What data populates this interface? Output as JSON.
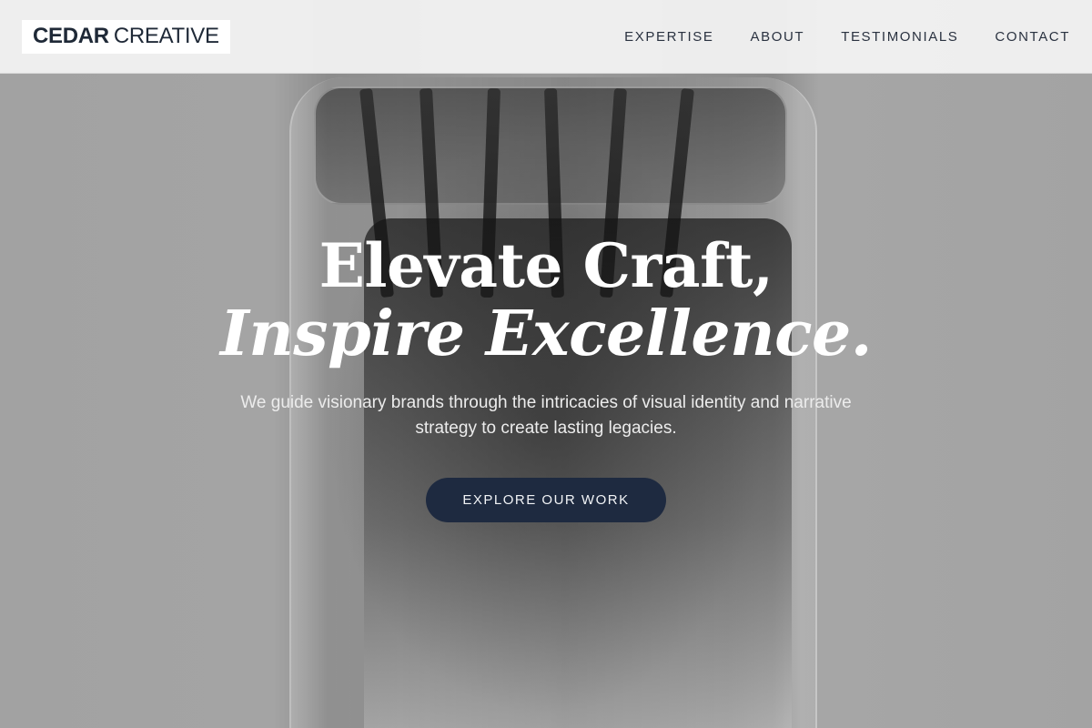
{
  "brand": {
    "name_bold": "CEDAR",
    "name_light": "CREATIVE"
  },
  "nav": {
    "items": [
      {
        "label": "EXPERTISE"
      },
      {
        "label": "ABOUT"
      },
      {
        "label": "TESTIMONIALS"
      },
      {
        "label": "CONTACT"
      }
    ]
  },
  "hero": {
    "headline_line1": "Elevate Craft,",
    "headline_line2": "Inspire Excellence.",
    "subtitle": "We guide visionary brands through the intricacies of visual identity and narrative strategy to create lasting legacies.",
    "cta_label": "EXPLORE OUR WORK",
    "background": "grayscale-photo-glass-jar-with-brushes"
  },
  "colors": {
    "nav_background": "#f2f2f2",
    "text_dark": "#1f2937",
    "cta_background": "#1e2a40",
    "hero_text": "#ffffff"
  }
}
